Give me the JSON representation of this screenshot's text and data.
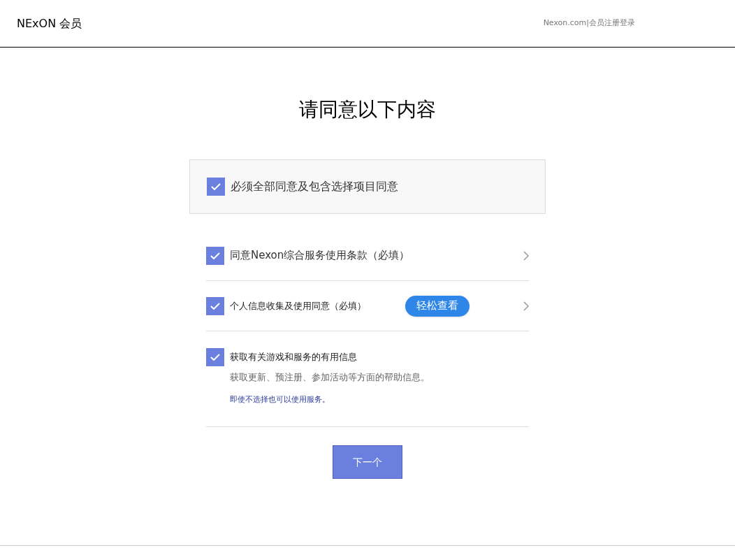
{
  "header": {
    "logo": "NExON 会员",
    "link": "Nexon.com|会员注册登录"
  },
  "title": "请同意以下内容",
  "agree_all": {
    "label": "必须全部同意及包含选择项目同意",
    "checked": true
  },
  "items": [
    {
      "kind": "link",
      "label": "同意Nexon综合服务使用条款（必填）",
      "checked": true
    },
    {
      "kind": "button",
      "label": "个人信息收集及使用同意（必填）",
      "checked": true,
      "button": "轻松查看"
    },
    {
      "kind": "detail",
      "label": "获取有关游戏和服务的有用信息",
      "checked": true,
      "description": "获取更新、预注册、参加活动等方面的帮助信息。",
      "note": "即使不选择也可以使用服务。"
    }
  ],
  "next_button": "下一个"
}
